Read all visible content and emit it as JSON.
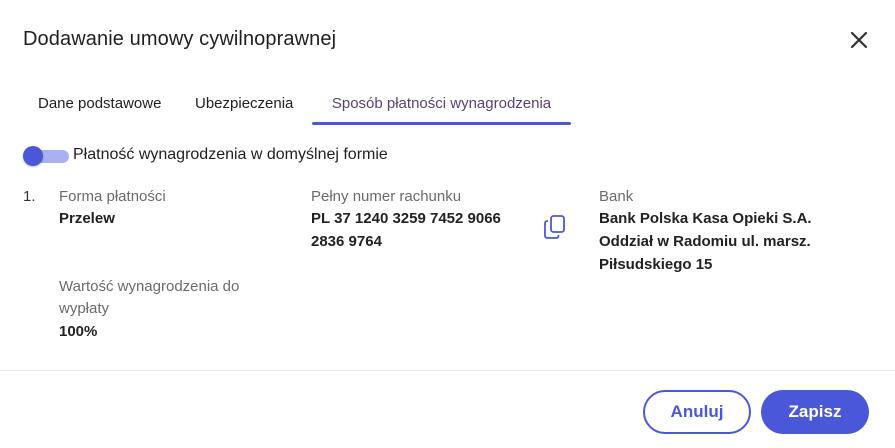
{
  "dialog": {
    "title": "Dodawanie umowy cywilnoprawnej",
    "close_icon": "close-icon"
  },
  "tabs": [
    {
      "label": "Dane podstawowe",
      "active": false
    },
    {
      "label": "Ubezpieczenia",
      "active": false
    },
    {
      "label": "Sposób płatności wynagrodzenia",
      "active": true
    }
  ],
  "toggle": {
    "label": "Płatność wynagrodzenia w domyślnej formie",
    "on": true
  },
  "payment": {
    "index": "1.",
    "method_label": "Forma płatności",
    "method_value": "Przelew",
    "account_label": "Pełny numer rachunku",
    "account_line1": "PL 37 1240 3259 7452 9066",
    "account_line2": "2836 9764",
    "copy_icon": "copy-icon",
    "bank_label": "Bank",
    "bank_line1": "Bank Polska Kasa Opieki S.A.",
    "bank_line2": "Oddział w Radomiu ul. marsz.",
    "bank_line3": "Piłsudskiego 15",
    "amount_label_line1": "Wartość wynagrodzenia do",
    "amount_label_line2": "wypłaty",
    "amount_value": "100%"
  },
  "footer": {
    "cancel_label": "Anuluj",
    "save_label": "Zapisz"
  },
  "colors": {
    "accent": "#4a57d8",
    "accent_light": "#a9b1f2",
    "active_tab_text": "#5b3f72"
  }
}
